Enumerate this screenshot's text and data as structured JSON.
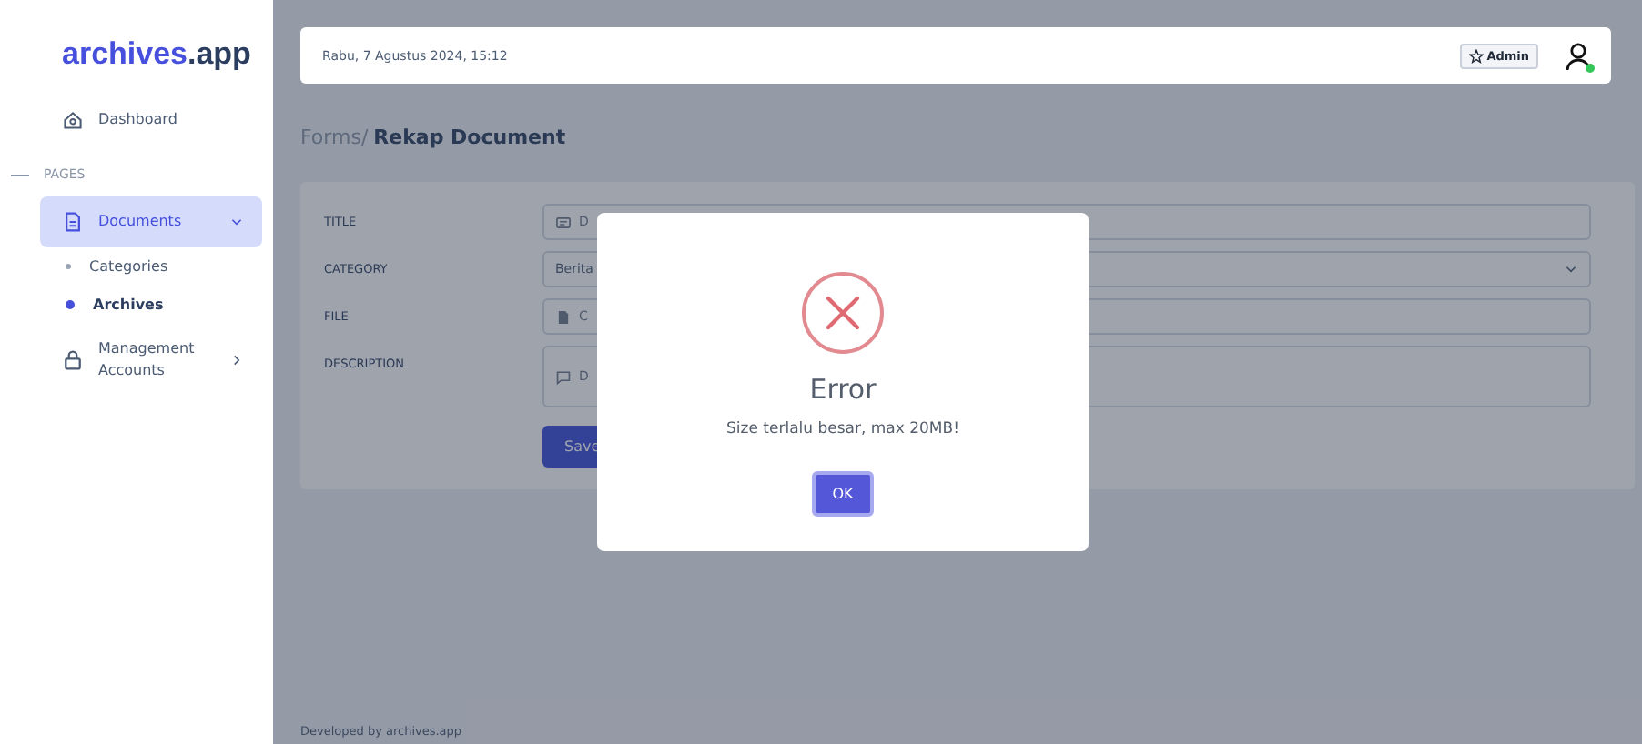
{
  "sidebar": {
    "logo": {
      "name": "archives",
      "suffix": ".app"
    },
    "items": [
      {
        "kind": "link",
        "label": "Dashboard",
        "selected": false
      },
      {
        "kind": "section",
        "label": "PAGES"
      },
      {
        "kind": "group",
        "label": "Documents",
        "expanded": true,
        "selected": true,
        "children": [
          {
            "label": "Categories",
            "selected": false
          },
          {
            "label": "Archives",
            "selected": true
          }
        ]
      },
      {
        "kind": "group",
        "label": "Management Accounts",
        "expanded": false,
        "selected": false
      }
    ]
  },
  "header": {
    "datetime": "Rabu, 7 Agustus 2024, 15:12",
    "role_badge": "Admin",
    "user_online": true
  },
  "breadcrumb": {
    "parent": "Forms/",
    "current_prefix": "Rekap",
    "current": "Document"
  },
  "form": {
    "fields": [
      {
        "label": "TITLE",
        "kind": "text",
        "placeholder": "D"
      },
      {
        "label": "CATEGORY",
        "kind": "select",
        "value": "Berita"
      },
      {
        "label": "FILE",
        "kind": "file",
        "placeholder": "C"
      },
      {
        "label": "DESCRIPTION",
        "kind": "textarea",
        "placeholder": "D"
      }
    ],
    "submit": "Save"
  },
  "dialog": {
    "kind": "error",
    "title": "Error",
    "message": "Size terlalu besar, max 20MB!",
    "button": "OK"
  },
  "footer": "Developed by archives.app"
}
